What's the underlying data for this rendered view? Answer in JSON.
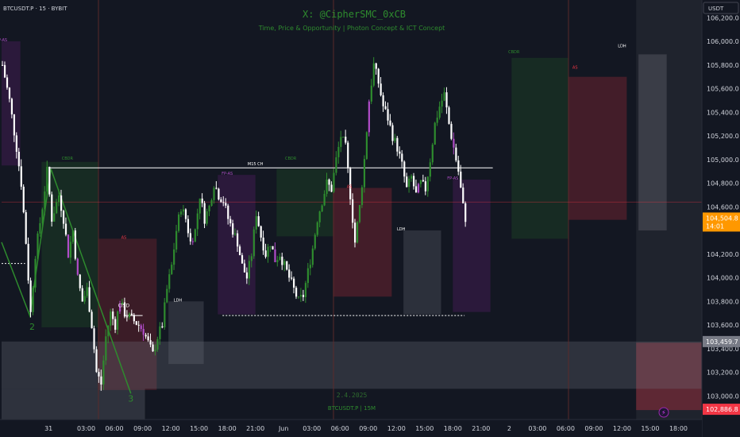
{
  "header": {
    "symbol_line": "BTCUSDT.P · 15 · BYBIT",
    "watermark_title": "X: @CipherSMC_0xCB",
    "watermark_subtitle": "Time, Price & Opportunity | Photon Concept & ICT Concept",
    "watermark_symbol": "BTCUSDT.P | 15M",
    "watermark_date": "2.4.2025",
    "currency": "USDT"
  },
  "colors": {
    "background": "#131722",
    "bull": "#2e8b2e",
    "bear": "#ffffff",
    "purple": "#b04cc8",
    "axis_text": "#d1d4dc",
    "current_price_bg": "#ff9800",
    "low_price_bg": "#f23645",
    "high_price_bg": "#787b86"
  },
  "chart_data": {
    "type": "candlestick",
    "y_axis": {
      "min": 102800,
      "max": 106350,
      "ticks": [
        106200,
        106000,
        105800,
        105600,
        105400,
        105200,
        105000,
        104800,
        104600,
        104200,
        104000,
        103800,
        103600,
        103400,
        103200,
        103000
      ],
      "tick_labels": [
        "106,200.0",
        "106,000.0",
        "105,800.0",
        "105,600.0",
        "105,400.0",
        "105,200.0",
        "105,000.0",
        "104,800.0",
        "104,600.0",
        "104,200.0",
        "104,000.0",
        "103,800.0",
        "103,600.0",
        "103,400.0",
        "103,200.0",
        "103,000.0"
      ]
    },
    "x_axis": {
      "tick_labels": [
        "31",
        "03:00",
        "06:00",
        "09:00",
        "12:00",
        "15:00",
        "18:00",
        "21:00",
        "Jun",
        "03:00",
        "06:00",
        "09:00",
        "12:00",
        "15:00",
        "18:00",
        "21:00",
        "2",
        "03:00",
        "06:00",
        "09:00",
        "12:00",
        "15:00",
        "18:00"
      ],
      "tick_index": [
        20,
        36,
        48,
        60,
        72,
        84,
        96,
        108,
        120,
        132,
        144,
        156,
        168,
        180,
        192,
        204,
        216,
        228,
        240,
        252,
        264,
        276,
        288
      ]
    },
    "grid": false,
    "price_badges": [
      {
        "label": "104,504.8",
        "sub": "14:01",
        "price": 104504.8,
        "kind": "current"
      },
      {
        "label": "103,459.7",
        "price": 103459.7,
        "kind": "high"
      },
      {
        "label": "102,886.8",
        "price": 102886.8,
        "kind": "low"
      }
    ],
    "close_path": [
      [
        0,
        105800
      ],
      [
        3,
        105500
      ],
      [
        6,
        105100
      ],
      [
        8,
        104800
      ],
      [
        10,
        104300
      ],
      [
        12,
        103700
      ],
      [
        14,
        104200
      ],
      [
        17,
        104600
      ],
      [
        19,
        104900
      ],
      [
        21,
        104500
      ],
      [
        24,
        104700
      ],
      [
        26,
        104500
      ],
      [
        28,
        104200
      ],
      [
        30,
        104400
      ],
      [
        32,
        104000
      ],
      [
        34,
        103800
      ],
      [
        36,
        103900
      ],
      [
        38,
        103600
      ],
      [
        40,
        103200
      ],
      [
        42,
        103100
      ],
      [
        44,
        103500
      ],
      [
        46,
        103700
      ],
      [
        48,
        103600
      ],
      [
        50,
        103800
      ],
      [
        52,
        103700
      ],
      [
        55,
        103650
      ],
      [
        58,
        103600
      ],
      [
        60,
        103550
      ],
      [
        62,
        103450
      ],
      [
        64,
        103350
      ],
      [
        66,
        103500
      ],
      [
        68,
        103600
      ],
      [
        70,
        103900
      ],
      [
        72,
        104100
      ],
      [
        74,
        104400
      ],
      [
        76,
        104600
      ],
      [
        78,
        104500
      ],
      [
        80,
        104300
      ],
      [
        82,
        104400
      ],
      [
        84,
        104700
      ],
      [
        86,
        104500
      ],
      [
        88,
        104600
      ],
      [
        90,
        104800
      ],
      [
        92,
        104700
      ],
      [
        94,
        104650
      ],
      [
        96,
        104500
      ],
      [
        98,
        104400
      ],
      [
        100,
        104300
      ],
      [
        102,
        104100
      ],
      [
        104,
        104000
      ],
      [
        106,
        104200
      ],
      [
        108,
        104550
      ],
      [
        110,
        104350
      ],
      [
        112,
        104200
      ],
      [
        114,
        104300
      ],
      [
        116,
        104150
      ],
      [
        118,
        104200
      ],
      [
        120,
        104100
      ],
      [
        122,
        104000
      ],
      [
        124,
        103900
      ],
      [
        126,
        103800
      ],
      [
        128,
        103850
      ],
      [
        130,
        104050
      ],
      [
        132,
        104250
      ],
      [
        134,
        104500
      ],
      [
        136,
        104650
      ],
      [
        138,
        104800
      ],
      [
        140,
        104750
      ],
      [
        142,
        105000
      ],
      [
        144,
        105200
      ],
      [
        146,
        105100
      ],
      [
        148,
        104700
      ],
      [
        150,
        104300
      ],
      [
        152,
        104600
      ],
      [
        154,
        105000
      ],
      [
        156,
        105500
      ],
      [
        158,
        105800
      ],
      [
        160,
        105650
      ],
      [
        162,
        105450
      ],
      [
        164,
        105350
      ],
      [
        166,
        105200
      ],
      [
        168,
        105100
      ],
      [
        170,
        104950
      ],
      [
        172,
        104750
      ],
      [
        174,
        104850
      ],
      [
        176,
        104700
      ],
      [
        178,
        104800
      ],
      [
        180,
        104750
      ],
      [
        182,
        105000
      ],
      [
        184,
        105300
      ],
      [
        186,
        105450
      ],
      [
        188,
        105550
      ],
      [
        190,
        105300
      ],
      [
        192,
        105100
      ],
      [
        194,
        104900
      ],
      [
        196,
        104600
      ],
      [
        197,
        104505
      ]
    ],
    "labels": [
      {
        "text": "M15 CH",
        "price": 104950,
        "index": 108
      },
      {
        "text": "CISD",
        "price": 103750,
        "index": 52
      },
      {
        "text": "LDH",
        "price": 103800,
        "index": 75
      },
      {
        "text": "LDH",
        "price": 104400,
        "index": 170
      },
      {
        "text": "LDH",
        "price": 105950,
        "index": 264
      },
      {
        "text": "2",
        "price": 103560,
        "index": 13
      },
      {
        "text": "3",
        "price": 102950,
        "index": 55
      },
      {
        "text": "CBDR",
        "price": 105000,
        "index": 28
      },
      {
        "text": "CBDR",
        "price": 105000,
        "index": 123
      },
      {
        "text": "CBDR",
        "price": 105900,
        "index": 218
      },
      {
        "text": "AS",
        "price": 104330,
        "index": 52
      },
      {
        "text": "AS",
        "price": 104760,
        "index": 148
      },
      {
        "text": "AS",
        "price": 105770,
        "index": 244
      },
      {
        "text": "FP-AS",
        "price": 104870,
        "index": 96
      },
      {
        "text": "FP-AS",
        "price": 104830,
        "index": 192
      },
      {
        "text": "FP-AS",
        "price": 106000,
        "index": 0
      }
    ]
  }
}
